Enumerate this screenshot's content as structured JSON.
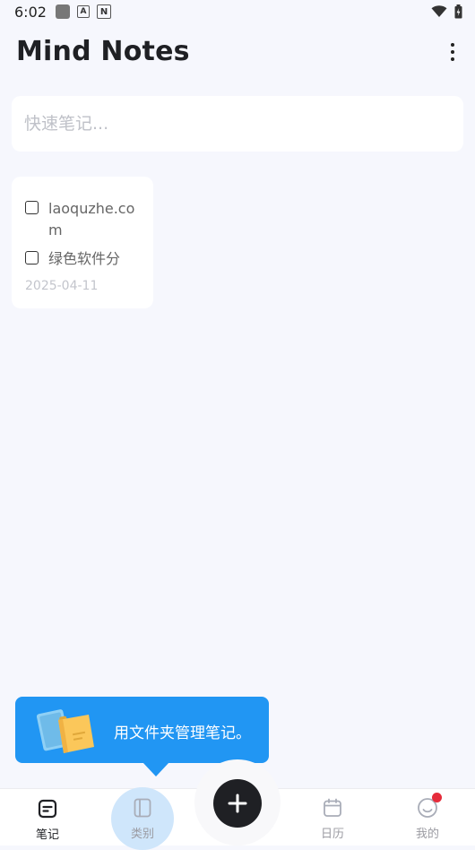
{
  "status_bar": {
    "time": "6:02",
    "a_glyph": "A",
    "n_glyph": "N"
  },
  "header": {
    "title": "Mind Notes"
  },
  "quick_note": {
    "placeholder": "快速笔记..."
  },
  "notes": [
    {
      "items": [
        "laoquzhe.com",
        "绿色软件分"
      ],
      "date": "2025-04-11"
    }
  ],
  "tooltip": {
    "text": "用文件夹管理笔记。"
  },
  "bottom_nav": {
    "items": [
      {
        "label": "笔记",
        "icon": "note-icon",
        "active": true
      },
      {
        "label": "类别",
        "icon": "folder-icon",
        "active": false
      },
      {
        "label": "日历",
        "icon": "calendar-icon",
        "active": false
      },
      {
        "label": "我的",
        "icon": "smile-icon",
        "active": false
      }
    ]
  },
  "colors": {
    "accent": "#2196f3",
    "background": "#f6f7fd",
    "badge": "#e52b3a",
    "fab": "#1f2024"
  }
}
